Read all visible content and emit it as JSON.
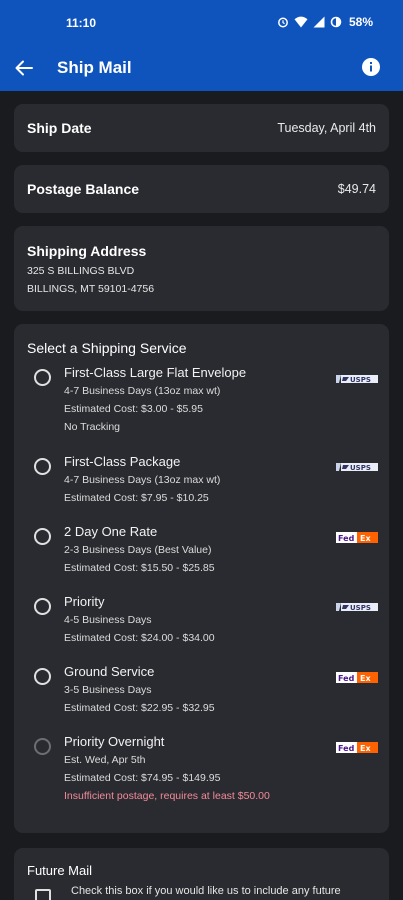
{
  "status_bar": {
    "time": "11:10",
    "battery": "58%",
    "icons": [
      "alarm-icon",
      "wifi-icon",
      "signal-icon",
      "battery-icon"
    ]
  },
  "toolbar": {
    "title": "Ship Mail",
    "back_icon": "arrow-left-icon",
    "info_icon": "info-icon"
  },
  "ship_date": {
    "label": "Ship Date",
    "value": "Tuesday, April 4th"
  },
  "postage_balance": {
    "label": "Postage Balance",
    "value": "$49.74"
  },
  "shipping_address": {
    "label": "Shipping Address",
    "line1": "325 S BILLINGS BLVD",
    "line2": "BILLINGS, MT 59101-4756"
  },
  "services": {
    "heading": "Select a Shipping Service",
    "items": [
      {
        "name": "First-Class Large Flat Envelope",
        "detail": "4-7 Business Days (13oz max wt)",
        "cost": "Estimated Cost: $3.00 - $5.95",
        "extra": "No Tracking",
        "carrier": "USPS",
        "enabled": true
      },
      {
        "name": "First-Class Package",
        "detail": "4-7 Business Days (13oz max wt)",
        "cost": "Estimated Cost: $7.95 - $10.25",
        "carrier": "USPS",
        "enabled": true
      },
      {
        "name": "2 Day One Rate",
        "detail": "2-3 Business Days (Best Value)",
        "cost": "Estimated Cost: $15.50 - $25.85",
        "carrier": "FedEx",
        "enabled": true
      },
      {
        "name": "Priority",
        "detail": "4-5 Business Days",
        "cost": "Estimated Cost: $24.00 - $34.00",
        "carrier": "USPS",
        "enabled": true
      },
      {
        "name": "Ground Service",
        "detail": "3-5 Business Days",
        "cost": "Estimated Cost: $22.95 - $32.95",
        "carrier": "FedEx",
        "enabled": true
      },
      {
        "name": "Priority Overnight",
        "detail": "Est. Wed, Apr 5th",
        "cost": "Estimated Cost: $74.95 - $149.95",
        "warning": "Insufficient postage, requires at least $50.00",
        "carrier": "FedEx",
        "enabled": false
      }
    ]
  },
  "future_mail": {
    "heading": "Future Mail",
    "text": "Check this box if you would like us to include any future"
  },
  "colors": {
    "appbar": "#0f54bd",
    "background": "#1a1b1f",
    "card": "#2a2b30",
    "warning": "#f28b9a",
    "fedex_purple": "#4d148c",
    "fedex_orange": "#ff6200"
  }
}
